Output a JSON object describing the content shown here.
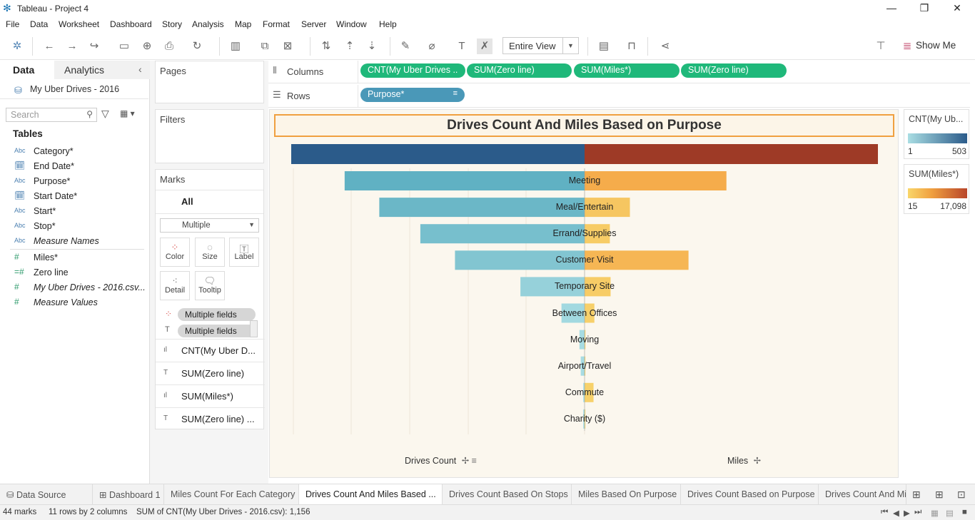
{
  "window": {
    "title": "Tableau - Project 4"
  },
  "menu": [
    "File",
    "Data",
    "Worksheet",
    "Dashboard",
    "Story",
    "Analysis",
    "Map",
    "Format",
    "Server",
    "Window",
    "Help"
  ],
  "toolbar": {
    "fit": "Entire View",
    "show_me": "Show Me"
  },
  "data_pane": {
    "tab_data": "Data",
    "tab_analytics": "Analytics",
    "datasource": "My Uber Drives - 2016",
    "search_placeholder": "Search",
    "tables_heading": "Tables",
    "dimensions": [
      {
        "icon": "Abc",
        "name": "Category*"
      },
      {
        "icon": "date",
        "name": "End Date*"
      },
      {
        "icon": "Abc",
        "name": "Purpose*"
      },
      {
        "icon": "date",
        "name": "Start Date*"
      },
      {
        "icon": "Abc",
        "name": "Start*"
      },
      {
        "icon": "Abc",
        "name": "Stop*"
      },
      {
        "icon": "Abc",
        "name": "Measure Names"
      }
    ],
    "measures": [
      {
        "icon": "#",
        "name": "Miles*"
      },
      {
        "icon": "#",
        "name": "Zero line"
      },
      {
        "icon": "#",
        "name": "My Uber Drives - 2016.csv..."
      },
      {
        "icon": "#",
        "name": "Measure Values"
      }
    ]
  },
  "cards": {
    "pages": "Pages",
    "filters": "Filters",
    "marks": "Marks",
    "marks_all": "All",
    "mark_type": "Multiple",
    "buttons": [
      "Color",
      "Size",
      "Label",
      "Detail",
      "Tooltip"
    ],
    "multiple_fields_1": "Multiple fields",
    "multiple_fields_2": "Multiple fields",
    "mark_rows": [
      "CNT(My Uber D...",
      "SUM(Zero line)",
      "SUM(Miles*)",
      "SUM(Zero line) ..."
    ]
  },
  "shelves": {
    "columns_label": "Columns",
    "rows_label": "Rows",
    "columns": [
      "CNT(My Uber Drives ..",
      "SUM(Zero line)",
      "SUM(Miles*)",
      "SUM(Zero line)"
    ],
    "rows": [
      "Purpose*"
    ]
  },
  "viz": {
    "title": "Drives Count And Miles Based on Purpose",
    "left_axis": "Drives Count",
    "right_axis": "Miles"
  },
  "chart_data": {
    "type": "bar",
    "title": "Drives Count And Miles Based on Purpose",
    "categories": [
      "Meeting",
      "Meal/Entertain",
      "Errand/Supplies",
      "Customer Visit",
      "Temporary Site",
      "Between Offices",
      "Moving",
      "Airport/Travel",
      "Commute",
      "Charity ($)"
    ],
    "series": [
      {
        "name": "Drives Count",
        "values": [
          187,
          160,
          128,
          101,
          50,
          18,
          4,
          3,
          1,
          1
        ],
        "color_low": "#9fd3dc",
        "color_high": "#2b5b8a"
      },
      {
        "name": "Miles",
        "values": [
          2851,
          911,
          508,
          2089,
          523,
          197,
          18,
          16,
          180,
          16
        ],
        "color_low": "#f9d66a",
        "color_high": "#9e3a26"
      }
    ],
    "total_bar": {
      "drives_count": 503,
      "miles": 17098
    },
    "xlabel_left": "Drives Count",
    "xlabel_right": "Miles"
  },
  "legends": [
    {
      "title": "CNT(My Ub...",
      "min": "1",
      "max": "503",
      "from": "#a9dde3",
      "to": "#2b5b8a"
    },
    {
      "title": "SUM(Miles*)",
      "min": "15",
      "max": "17,098",
      "from": "#f9d66a",
      "to": "#b8452a"
    }
  ],
  "sheet_tabs": [
    "Data Source",
    "Dashboard 1",
    "Miles Count For Each Category",
    "Drives Count And Miles Based ...",
    "Drives Count Based On Stops",
    "Miles Based On Purpose",
    "Drives Count Based on Purpose",
    "Drives Count And Mi"
  ],
  "status": {
    "marks": "44 marks",
    "rows_cols": "11 rows by 2 columns",
    "sum": "SUM of CNT(My Uber Drives - 2016.csv): 1,156"
  }
}
